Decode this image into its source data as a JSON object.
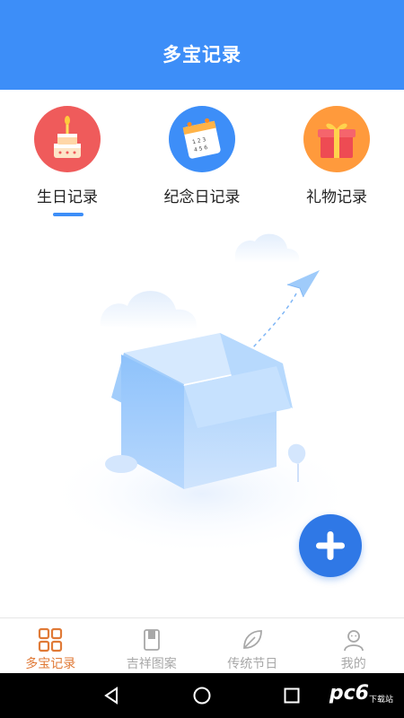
{
  "header": {
    "title": "多宝记录"
  },
  "categories": [
    {
      "label": "生日记录",
      "icon": "birthday-cake-icon",
      "color": "#ef5b5b"
    },
    {
      "label": "纪念日记录",
      "icon": "calendar-icon",
      "color": "#3d8ef8"
    },
    {
      "label": "礼物记录",
      "icon": "gift-box-icon",
      "color": "#ff9a3c"
    }
  ],
  "active_category": "生日记录",
  "fab": {
    "icon": "plus-icon"
  },
  "bottom_nav": [
    {
      "label": "多宝记录",
      "icon": "grid-icon",
      "active": true
    },
    {
      "label": "吉祥图案",
      "icon": "book-icon",
      "active": false
    },
    {
      "label": "传统节日",
      "icon": "leaf-icon",
      "active": false
    },
    {
      "label": "我的",
      "icon": "person-icon",
      "active": false
    }
  ],
  "colors": {
    "primary": "#3d8ef8",
    "nav_active": "#e07a37",
    "nav_inactive": "#a8a8a8"
  },
  "watermark": {
    "text": "pc6",
    "sub": "下载站"
  }
}
